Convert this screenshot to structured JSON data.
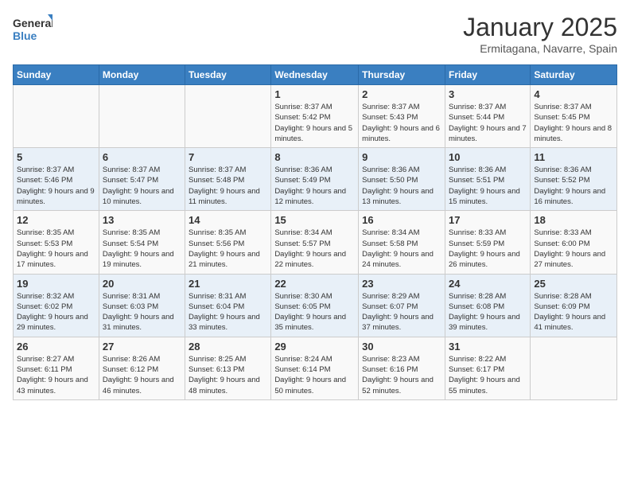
{
  "logo": {
    "text_general": "General",
    "text_blue": "Blue"
  },
  "header": {
    "month_title": "January 2025",
    "subtitle": "Ermitagana, Navarre, Spain"
  },
  "weekdays": [
    "Sunday",
    "Monday",
    "Tuesday",
    "Wednesday",
    "Thursday",
    "Friday",
    "Saturday"
  ],
  "weeks": [
    [
      {
        "day": "",
        "info": ""
      },
      {
        "day": "",
        "info": ""
      },
      {
        "day": "",
        "info": ""
      },
      {
        "day": "1",
        "info": "Sunrise: 8:37 AM\nSunset: 5:42 PM\nDaylight: 9 hours and 5 minutes."
      },
      {
        "day": "2",
        "info": "Sunrise: 8:37 AM\nSunset: 5:43 PM\nDaylight: 9 hours and 6 minutes."
      },
      {
        "day": "3",
        "info": "Sunrise: 8:37 AM\nSunset: 5:44 PM\nDaylight: 9 hours and 7 minutes."
      },
      {
        "day": "4",
        "info": "Sunrise: 8:37 AM\nSunset: 5:45 PM\nDaylight: 9 hours and 8 minutes."
      }
    ],
    [
      {
        "day": "5",
        "info": "Sunrise: 8:37 AM\nSunset: 5:46 PM\nDaylight: 9 hours and 9 minutes."
      },
      {
        "day": "6",
        "info": "Sunrise: 8:37 AM\nSunset: 5:47 PM\nDaylight: 9 hours and 10 minutes."
      },
      {
        "day": "7",
        "info": "Sunrise: 8:37 AM\nSunset: 5:48 PM\nDaylight: 9 hours and 11 minutes."
      },
      {
        "day": "8",
        "info": "Sunrise: 8:36 AM\nSunset: 5:49 PM\nDaylight: 9 hours and 12 minutes."
      },
      {
        "day": "9",
        "info": "Sunrise: 8:36 AM\nSunset: 5:50 PM\nDaylight: 9 hours and 13 minutes."
      },
      {
        "day": "10",
        "info": "Sunrise: 8:36 AM\nSunset: 5:51 PM\nDaylight: 9 hours and 15 minutes."
      },
      {
        "day": "11",
        "info": "Sunrise: 8:36 AM\nSunset: 5:52 PM\nDaylight: 9 hours and 16 minutes."
      }
    ],
    [
      {
        "day": "12",
        "info": "Sunrise: 8:35 AM\nSunset: 5:53 PM\nDaylight: 9 hours and 17 minutes."
      },
      {
        "day": "13",
        "info": "Sunrise: 8:35 AM\nSunset: 5:54 PM\nDaylight: 9 hours and 19 minutes."
      },
      {
        "day": "14",
        "info": "Sunrise: 8:35 AM\nSunset: 5:56 PM\nDaylight: 9 hours and 21 minutes."
      },
      {
        "day": "15",
        "info": "Sunrise: 8:34 AM\nSunset: 5:57 PM\nDaylight: 9 hours and 22 minutes."
      },
      {
        "day": "16",
        "info": "Sunrise: 8:34 AM\nSunset: 5:58 PM\nDaylight: 9 hours and 24 minutes."
      },
      {
        "day": "17",
        "info": "Sunrise: 8:33 AM\nSunset: 5:59 PM\nDaylight: 9 hours and 26 minutes."
      },
      {
        "day": "18",
        "info": "Sunrise: 8:33 AM\nSunset: 6:00 PM\nDaylight: 9 hours and 27 minutes."
      }
    ],
    [
      {
        "day": "19",
        "info": "Sunrise: 8:32 AM\nSunset: 6:02 PM\nDaylight: 9 hours and 29 minutes."
      },
      {
        "day": "20",
        "info": "Sunrise: 8:31 AM\nSunset: 6:03 PM\nDaylight: 9 hours and 31 minutes."
      },
      {
        "day": "21",
        "info": "Sunrise: 8:31 AM\nSunset: 6:04 PM\nDaylight: 9 hours and 33 minutes."
      },
      {
        "day": "22",
        "info": "Sunrise: 8:30 AM\nSunset: 6:05 PM\nDaylight: 9 hours and 35 minutes."
      },
      {
        "day": "23",
        "info": "Sunrise: 8:29 AM\nSunset: 6:07 PM\nDaylight: 9 hours and 37 minutes."
      },
      {
        "day": "24",
        "info": "Sunrise: 8:28 AM\nSunset: 6:08 PM\nDaylight: 9 hours and 39 minutes."
      },
      {
        "day": "25",
        "info": "Sunrise: 8:28 AM\nSunset: 6:09 PM\nDaylight: 9 hours and 41 minutes."
      }
    ],
    [
      {
        "day": "26",
        "info": "Sunrise: 8:27 AM\nSunset: 6:11 PM\nDaylight: 9 hours and 43 minutes."
      },
      {
        "day": "27",
        "info": "Sunrise: 8:26 AM\nSunset: 6:12 PM\nDaylight: 9 hours and 46 minutes."
      },
      {
        "day": "28",
        "info": "Sunrise: 8:25 AM\nSunset: 6:13 PM\nDaylight: 9 hours and 48 minutes."
      },
      {
        "day": "29",
        "info": "Sunrise: 8:24 AM\nSunset: 6:14 PM\nDaylight: 9 hours and 50 minutes."
      },
      {
        "day": "30",
        "info": "Sunrise: 8:23 AM\nSunset: 6:16 PM\nDaylight: 9 hours and 52 minutes."
      },
      {
        "day": "31",
        "info": "Sunrise: 8:22 AM\nSunset: 6:17 PM\nDaylight: 9 hours and 55 minutes."
      },
      {
        "day": "",
        "info": ""
      }
    ]
  ]
}
